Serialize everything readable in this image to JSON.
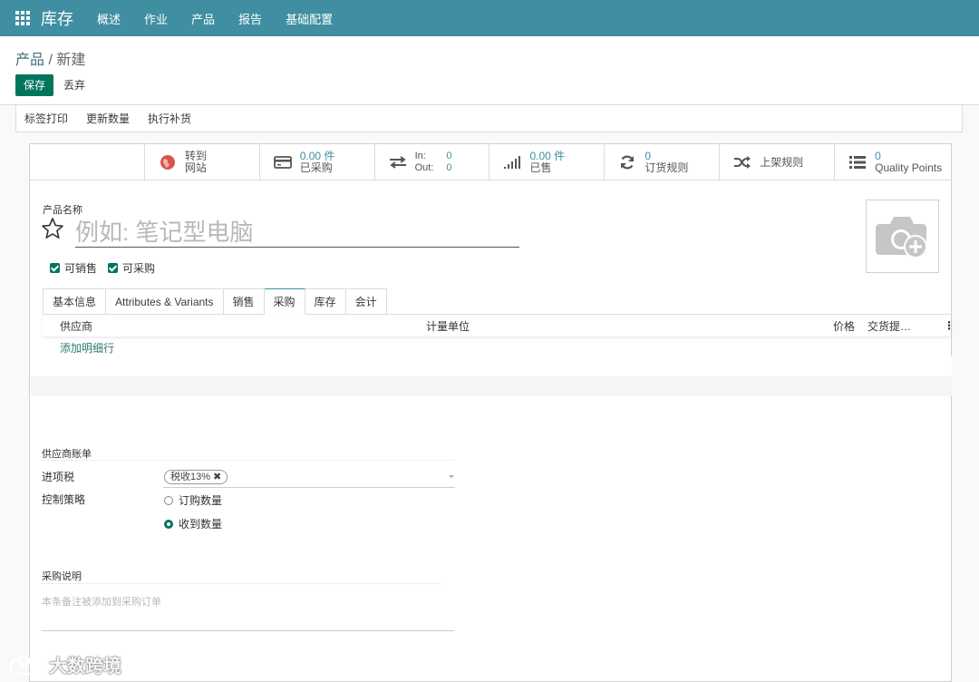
{
  "topnav": {
    "app_name": "库存",
    "items": [
      "概述",
      "作业",
      "产品",
      "报告",
      "基础配置"
    ]
  },
  "breadcrumb": {
    "parent": "产品",
    "separator": " / ",
    "current": "新建"
  },
  "control": {
    "save_label": "保存",
    "discard_label": "丢弃"
  },
  "actions": [
    "标签打印",
    "更新数量",
    "执行补货"
  ],
  "button_box": {
    "website": {
      "line1": "转到",
      "line2": "网站",
      "icon": "globe-icon"
    },
    "purchased": {
      "value": "0.00 件",
      "label": "已采购",
      "icon": "credit-card-icon"
    },
    "in_out": {
      "in_label": "In:",
      "in_value": "0",
      "out_label": "Out:",
      "out_value": "0",
      "icon": "exchange-icon"
    },
    "sold": {
      "value": "0.00 件",
      "label": "已售",
      "icon": "signal-bars-icon"
    },
    "reorder": {
      "value": "0",
      "label": "订货规则",
      "icon": "refresh-icon"
    },
    "putaway": {
      "label": "上架规则",
      "icon": "random-icon"
    },
    "quality": {
      "value": "0",
      "label": "Quality Points",
      "icon": "list-icon"
    }
  },
  "product": {
    "name_label": "产品名称",
    "name_placeholder": "例如: 笔记型电脑",
    "can_be_sold_label": "可销售",
    "can_be_sold": true,
    "can_be_purchased_label": "可采购",
    "can_be_purchased": true
  },
  "tabs": [
    {
      "label": "基本信息",
      "active": false
    },
    {
      "label": "Attributes & Variants",
      "active": false
    },
    {
      "label": "销售",
      "active": false
    },
    {
      "label": "采购",
      "active": true
    },
    {
      "label": "库存",
      "active": false
    },
    {
      "label": "会计",
      "active": false
    }
  ],
  "vendor_table": {
    "columns": {
      "vendor": "供应商",
      "uom": "计量单位",
      "price": "价格",
      "delay": "交货提…",
      "menu": "⋮"
    },
    "add_line": "添加明细行"
  },
  "vendor_bills": {
    "title": "供应商账单",
    "tax_label": "进项税",
    "tax_tag": "税收13%",
    "tax_remove": "✖",
    "policy_label": "控制策略",
    "policy_options": [
      {
        "label": "订购数量",
        "selected": false
      },
      {
        "label": "收到数量",
        "selected": true
      }
    ]
  },
  "purchase_description": {
    "title": "采购说明",
    "placeholder": "本条备注被添加到采购订单"
  },
  "watermark": {
    "text": "大数跨境"
  },
  "colors": {
    "navbar": "#3f8ea1",
    "primary_button": "#00755e",
    "link": "#2f7b6e"
  }
}
